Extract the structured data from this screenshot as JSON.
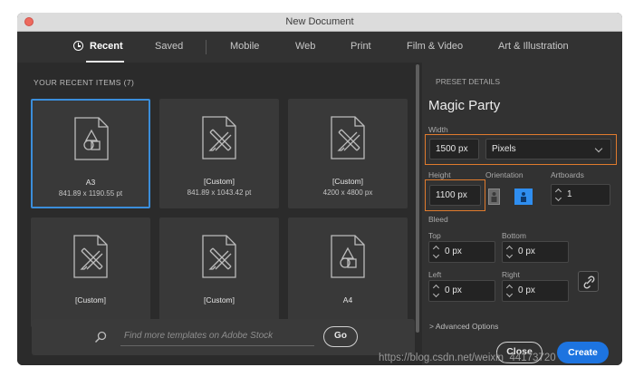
{
  "window": {
    "title": "New Document"
  },
  "tabs": [
    {
      "label": "Recent"
    },
    {
      "label": "Saved"
    },
    {
      "label": "Mobile"
    },
    {
      "label": "Web"
    },
    {
      "label": "Print"
    },
    {
      "label": "Film & Video"
    },
    {
      "label": "Art & Illustration"
    }
  ],
  "recent": {
    "heading": "YOUR RECENT ITEMS  (7)",
    "items": [
      {
        "name": "A3",
        "size": "841.89 x 1190.55 pt",
        "icon": "shapes-doc-icon"
      },
      {
        "name": "[Custom]",
        "size": "841.89 x 1043.42 pt",
        "icon": "pencil-ruler-doc-icon"
      },
      {
        "name": "[Custom]",
        "size": "4200 x 4800 px",
        "icon": "pencil-ruler-doc-icon"
      },
      {
        "name": "[Custom]",
        "size": "",
        "icon": "pencil-ruler-doc-icon"
      },
      {
        "name": "[Custom]",
        "size": "",
        "icon": "pencil-ruler-doc-icon"
      },
      {
        "name": "A4",
        "size": "",
        "icon": "shapes-doc-icon"
      }
    ]
  },
  "search": {
    "placeholder": "Find more templates on Adobe Stock",
    "go_label": "Go"
  },
  "preset": {
    "heading": "PRESET DETAILS",
    "name": "Magic Party",
    "width_label": "Width",
    "width_value": "1500 px",
    "units_value": "Pixels",
    "height_label": "Height",
    "height_value": "1100 px",
    "orientation_label": "Orientation",
    "artboards_label": "Artboards",
    "artboards_value": "1",
    "bleed_label": "Bleed",
    "top_label": "Top",
    "top_value": "0 px",
    "bottom_label": "Bottom",
    "bottom_value": "0 px",
    "left_label": "Left",
    "left_value": "0 px",
    "right_label": "Right",
    "right_value": "0 px",
    "advanced_label": "> Advanced Options"
  },
  "buttons": {
    "close": "Close",
    "create": "Create"
  },
  "watermark": "https://blog.csdn.net/weixin_44173720",
  "colors": {
    "accent": "#1d74e0",
    "highlight": "#e07b2d",
    "selected": "#3b8edb"
  }
}
